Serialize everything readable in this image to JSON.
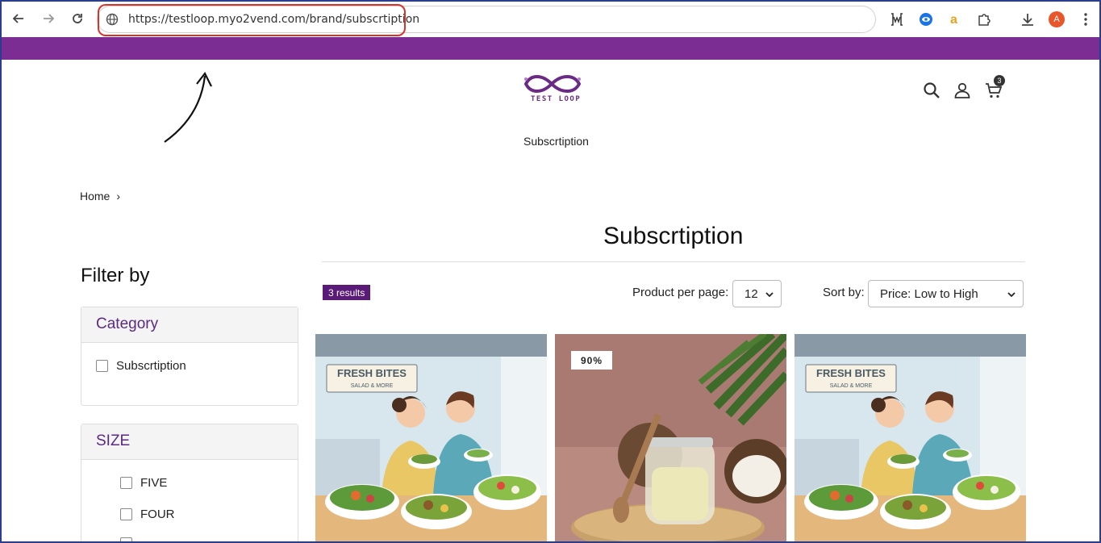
{
  "browser": {
    "url": "https://testloop.myo2vend.com/brand/subscrtiption",
    "profile_initial": "A"
  },
  "brand": {
    "logo_text": "TEST LOOP",
    "accent_color": "#7b2d94"
  },
  "header": {
    "cart_count": "3",
    "nav_link": "Subscrtiption"
  },
  "breadcrumb": {
    "home": "Home",
    "separator": "›"
  },
  "page": {
    "title": "Subscrtiption"
  },
  "filters": {
    "title": "Filter by",
    "category": {
      "heading": "Category",
      "options": [
        "Subscrtiption"
      ]
    },
    "size": {
      "heading": "SIZE",
      "options": [
        "FIVE",
        "FOUR"
      ]
    }
  },
  "toolbar": {
    "results": "3 results",
    "per_page_label": "Product per page:",
    "per_page_value": "12",
    "sort_label": "Sort by:",
    "sort_value": "Price: Low to High"
  },
  "products": [
    {
      "image": "fresh-bites-salad",
      "sign_title": "FRESH BITES",
      "sign_sub": "SALAD & MORE"
    },
    {
      "image": "coconut-oil-jar",
      "discount": "90%"
    },
    {
      "image": "fresh-bites-salad",
      "sign_title": "FRESH BITES",
      "sign_sub": "SALAD & MORE"
    }
  ]
}
